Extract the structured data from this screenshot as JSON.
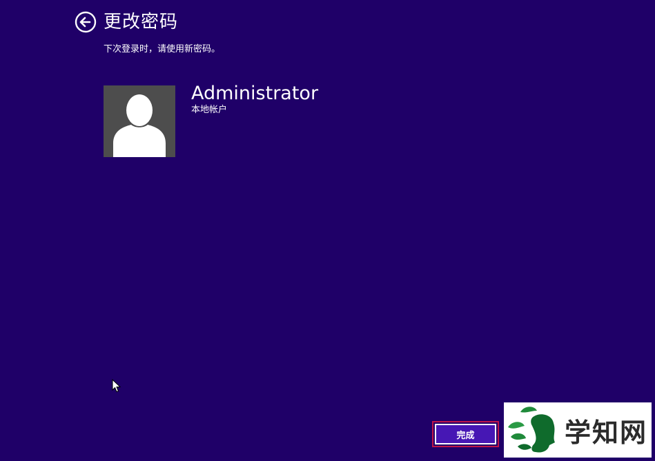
{
  "header": {
    "title": "更改密码",
    "back_icon": "back-arrow-circle-icon"
  },
  "subtitle": "下次登录时，请使用新密码。",
  "account": {
    "name": "Administrator",
    "type": "本地帐户",
    "avatar_icon": "user-silhouette-icon"
  },
  "actions": {
    "finish_label": "完成"
  },
  "watermark": {
    "text": "学知网",
    "logo_icon": "leaf-head-logo"
  },
  "colors": {
    "background": "#1f0068",
    "button_fill": "#4617b4",
    "button_focus_border": "#c0154a",
    "avatar_bg": "#4d4d4d"
  }
}
